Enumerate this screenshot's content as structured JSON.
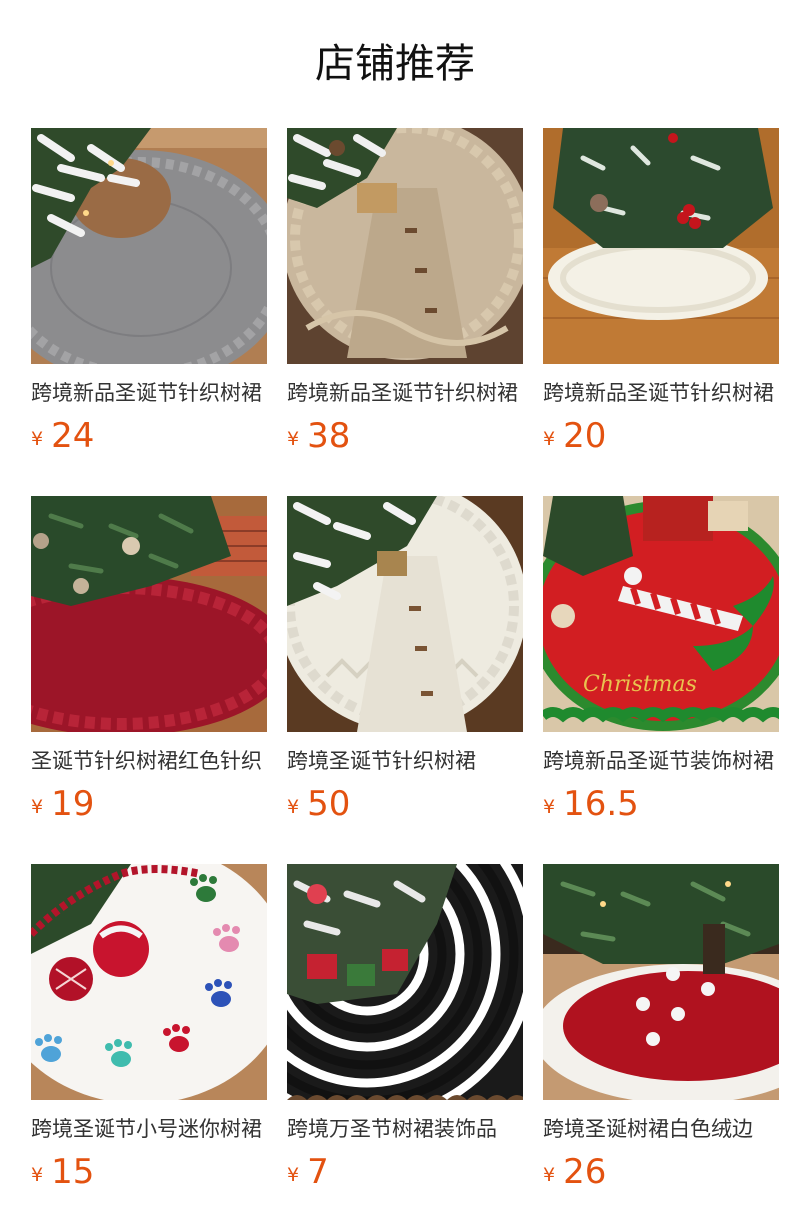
{
  "page": {
    "title": "店铺推荐"
  },
  "products": [
    {
      "name": "跨境新品圣诞节针织树裙",
      "currency": "¥",
      "price": "24",
      "image": "grey-knit-tree-skirt"
    },
    {
      "name": "跨境新品圣诞节针织树裙",
      "currency": "¥",
      "price": "38",
      "image": "beige-knit-tree-skirt"
    },
    {
      "name": "跨境新品圣诞节针织树裙",
      "currency": "¥",
      "price": "20",
      "image": "white-knit-mini-tree-skirt"
    },
    {
      "name": "圣诞节针织树裙红色针织",
      "currency": "¥",
      "price": "19",
      "image": "red-knit-tree-skirt"
    },
    {
      "name": "跨境圣诞节针织树裙",
      "currency": "¥",
      "price": "50",
      "image": "cream-knit-tree-skirt"
    },
    {
      "name": "跨境新品圣诞节装饰树裙",
      "currency": "¥",
      "price": "16.5",
      "image": "elf-legs-red-tree-skirt"
    },
    {
      "name": "跨境圣诞节小号迷你树裙",
      "currency": "¥",
      "price": "15",
      "image": "paw-print-white-tree-skirt"
    },
    {
      "name": "跨境万圣节树裙装饰品",
      "currency": "¥",
      "price": "7",
      "image": "black-white-stripe-tree-skirt"
    },
    {
      "name": "跨境圣诞树裙白色绒边",
      "currency": "¥",
      "price": "26",
      "image": "red-white-plush-tree-skirt"
    }
  ]
}
